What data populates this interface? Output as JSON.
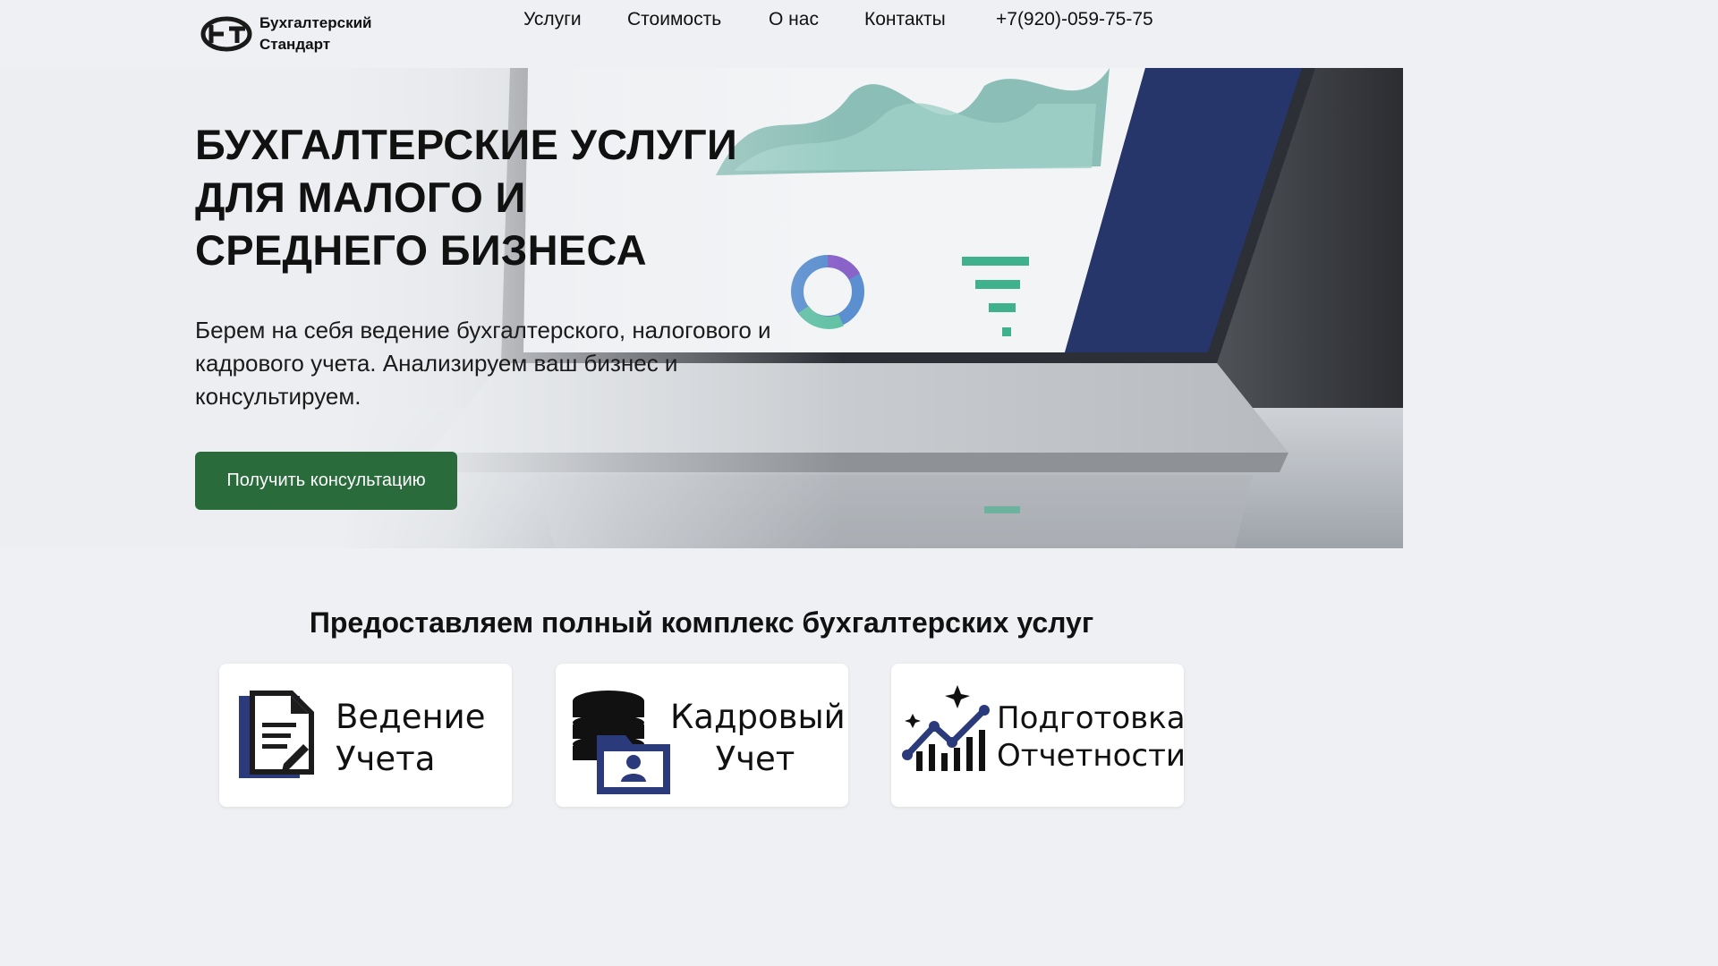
{
  "brand": {
    "line1": "Бухгалтерский",
    "line2": "Стандарт",
    "logo_icon": "bs-monogram-logo"
  },
  "nav": {
    "services": "Услуги",
    "price": "Стоимость",
    "about": "О нас",
    "contacts": "Контакты",
    "phone": "+7(920)-059-75-75"
  },
  "hero": {
    "title": "БУХГАЛТЕРСКИЕ УСЛУГИ ДЛЯ МАЛОГО И СРЕДНЕГО БИЗНЕСА",
    "subtitle": "Берем на себя ведение бухгалтерского, налогового и кадрового учета. Анализируем ваш бизнес и консультируем.",
    "cta": "Получить консультацию",
    "background": "laptop-analytics-dashboard-photo"
  },
  "services": {
    "title": "Предоставляем полный комплекс бухгалтерских услуг",
    "cards": [
      {
        "line1": "Ведение",
        "line2": "Учета",
        "icon": "document-edit-icon"
      },
      {
        "line1": "Кадровый",
        "line2": "Учет",
        "icon": "database-user-folder-icon"
      },
      {
        "line1": "Подготовка",
        "line2": "Отчетности",
        "icon": "growth-chart-sparkle-icon"
      }
    ]
  },
  "colors": {
    "accent_green": "#2a6b3c",
    "icon_navy": "#2b3a7a",
    "page_bg": "#eef0f3"
  }
}
